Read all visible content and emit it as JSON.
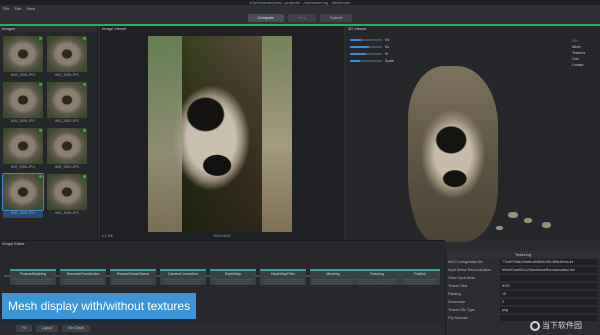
{
  "app": {
    "title": "d:/photoscan/pics/...projects/.../monstree.mg - Meshroom",
    "menu": [
      "File",
      "Edit",
      "View"
    ]
  },
  "toolbar": {
    "compute_label": "Compute",
    "stop_label": "Stop",
    "submit_label": "Submit",
    "status_color": "#2ab24f"
  },
  "images_panel": {
    "title": "Images",
    "count_label": "17 images",
    "thumbnails": [
      {
        "name": "IMG_3056.JPG",
        "selected": false
      },
      {
        "name": "IMG_3055.JPG",
        "selected": false
      },
      {
        "name": "IMG_3054.JPG",
        "selected": false
      },
      {
        "name": "IMG_3053.JPG",
        "selected": false
      },
      {
        "name": "IMG_3052.JPG",
        "selected": false
      },
      {
        "name": "IMG_3051.JPG",
        "selected": false
      },
      {
        "name": "IMG_3050.JPG",
        "selected": true
      },
      {
        "name": "IMG_3049.JPG",
        "selected": false
      }
    ]
  },
  "image_viewer": {
    "title": "Image Viewer",
    "zoom_label": "0.1 Mb",
    "resolution_label": "3024x4032"
  },
  "viewer_3d": {
    "title": "3D Viewer",
    "sliders": [
      {
        "label": "Kd",
        "value": 0.35
      },
      {
        "label": "Ks",
        "value": 0.6
      },
      {
        "label": "Kf",
        "value": 0.5
      },
      {
        "label": "Scale",
        "value": 0.3
      }
    ],
    "toggles": [
      {
        "label": "SfM",
        "enabled": false
      },
      {
        "label": "Mesh",
        "enabled": true
      },
      {
        "label": "Textures",
        "enabled": true
      },
      {
        "label": "Grid",
        "enabled": true
      },
      {
        "label": "Locator",
        "enabled": true
      }
    ]
  },
  "graph_editor": {
    "title": "Graph Editor",
    "nodes": [
      "FeatureMatching",
      "StructureFromMotion",
      "PrepareDenseScene",
      "CameraConnection",
      "DepthMap",
      "DepthMapFilter",
      "Meshing",
      "Texturing",
      "Publish"
    ],
    "accent": "#3aa0a0"
  },
  "caption": {
    "text": "Mesh display with/without textures"
  },
  "bottom_bar": {
    "fit_label": "Fit",
    "layout_label": "Layout",
    "min_depth_label": "Min Depth"
  },
  "texturing_attrs": {
    "title": "Texturing",
    "rows": [
      {
        "key": "MVS Configuration file",
        "value": "77bd57266c22b6bcc60f6f3c301485c3/mvs.ini"
      },
      {
        "key": "Input Dense Reconstruction",
        "value": "694e87ca0641c2f4cc/denseReconstruction.bin"
      },
      {
        "key": "Other Input Mesh",
        "value": ""
      },
      {
        "key": "Texture Side",
        "value": "8192"
      },
      {
        "key": "Padding",
        "value": "15"
      },
      {
        "key": "Downscale",
        "value": "2"
      },
      {
        "key": "Texture File Type",
        "value": "png"
      },
      {
        "key": "Flip Normals",
        "value": ""
      }
    ]
  },
  "watermark": {
    "text": "当下软件园"
  }
}
